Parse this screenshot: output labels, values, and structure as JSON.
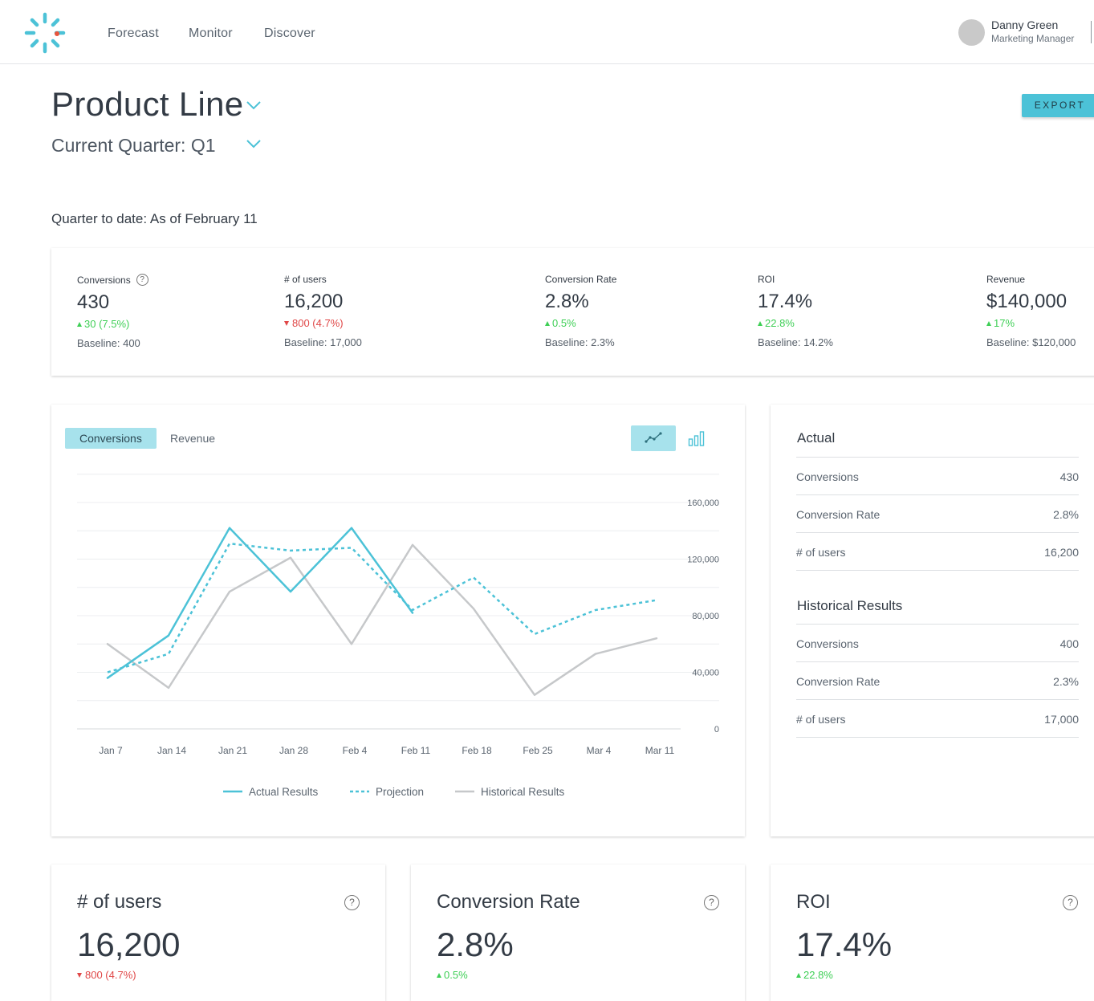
{
  "nav": {
    "items": [
      "Forecast",
      "Monitor",
      "Discover"
    ]
  },
  "user": {
    "name": "Danny Green",
    "role": "Marketing Manager"
  },
  "page": {
    "title": "Product Line",
    "quarter": "Current Quarter: Q1",
    "export_label": "EXPORT",
    "qtd": "Quarter to date: As of February 11"
  },
  "kpis": [
    {
      "title": "Conversions",
      "value": "430",
      "delta": "30 (7.5%)",
      "direction": "up",
      "baseline": "Baseline: 400"
    },
    {
      "title": "# of users",
      "value": "16,200",
      "delta": "800 (4.7%)",
      "direction": "down",
      "baseline": "Baseline: 17,000"
    },
    {
      "title": "Conversion Rate",
      "value": "2.8%",
      "delta": "0.5%",
      "direction": "up",
      "baseline": "Baseline: 2.3%"
    },
    {
      "title": "ROI",
      "value": "17.4%",
      "delta": "22.8%",
      "direction": "up",
      "baseline": "Baseline: 14.2%"
    },
    {
      "title": "Revenue",
      "value": "$140,000",
      "delta": "17%",
      "direction": "up",
      "baseline": "Baseline: $120,000"
    }
  ],
  "chart_tabs": [
    "Conversions",
    "Revenue"
  ],
  "help_glyph": "?",
  "chart_data": {
    "type": "line",
    "x": [
      "Jan 7",
      "Jan 14",
      "Jan 21",
      "Jan 28",
      "Feb 4",
      "Feb 11",
      "Feb 18",
      "Feb 25",
      "Mar 4",
      "Mar 11"
    ],
    "y_ticks": [
      "0",
      "40,000",
      "80,000",
      "120,000",
      "160,000"
    ],
    "ylim": [
      0,
      180000
    ],
    "grid": true,
    "legend": "bottom",
    "series": [
      {
        "name": "Actual Results",
        "style": "solid",
        "color": "#4cc2d7",
        "values": [
          36000,
          66000,
          142000,
          97000,
          142000,
          82000,
          null,
          null,
          null,
          null
        ]
      },
      {
        "name": "Projection",
        "style": "dashed",
        "color": "#4cc2d7",
        "values": [
          40000,
          53000,
          131000,
          126000,
          128000,
          84000,
          107000,
          67000,
          84000,
          91000
        ]
      },
      {
        "name": "Historical Results",
        "style": "solid",
        "color": "#c6c8ca",
        "values": [
          60000,
          29000,
          97000,
          121000,
          60000,
          130000,
          85000,
          24000,
          53000,
          64000
        ]
      }
    ]
  },
  "side": {
    "actual_heading": "Actual",
    "actual_rows": [
      {
        "label": "Conversions",
        "value": "430"
      },
      {
        "label": "Conversion Rate",
        "value": "2.8%"
      },
      {
        "label": "# of users",
        "value": "16,200"
      }
    ],
    "historical_heading": "Historical Results",
    "historical_rows": [
      {
        "label": "Conversions",
        "value": "400"
      },
      {
        "label": "Conversion Rate",
        "value": "2.3%"
      },
      {
        "label": "# of users",
        "value": "17,000"
      }
    ]
  },
  "bottom_cards": [
    {
      "title": "# of users",
      "value": "16,200",
      "delta": "800 (4.7%)",
      "direction": "down"
    },
    {
      "title": "Conversion Rate",
      "value": "2.8%",
      "delta": "0.5%",
      "direction": "up"
    },
    {
      "title": "ROI",
      "value": "17.4%",
      "delta": "22.8%",
      "direction": "up"
    }
  ],
  "colors": {
    "accent": "#4cc2d7",
    "accent_light": "#a7e2ec",
    "up": "#3fcf56",
    "down": "#e04848",
    "historical": "#c6c8ca"
  }
}
